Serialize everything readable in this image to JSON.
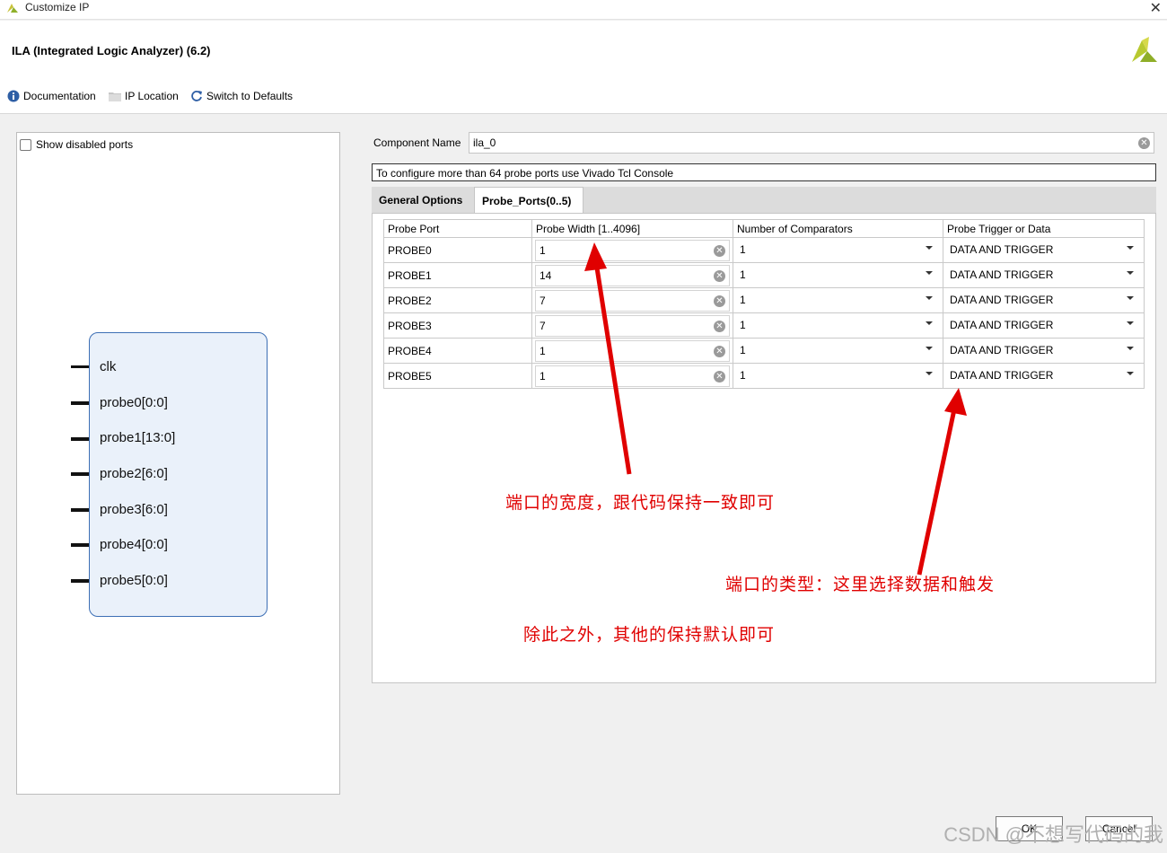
{
  "window": {
    "title": "Customize IP",
    "close_glyph": "✕"
  },
  "header": {
    "ip_name": "ILA (Integrated Logic Analyzer) (6.2)"
  },
  "toolbar": {
    "documentation": "Documentation",
    "ip_location": "IP Location",
    "switch_defaults": "Switch to Defaults"
  },
  "left": {
    "show_disabled_ports": "Show disabled ports",
    "ports": [
      "clk",
      "probe0[0:0]",
      "probe1[13:0]",
      "probe2[6:0]",
      "probe3[6:0]",
      "probe4[0:0]",
      "probe5[0:0]"
    ]
  },
  "component": {
    "label": "Component Name",
    "value": "ila_0"
  },
  "info_text": "To configure more than 64 probe ports use Vivado Tcl Console",
  "tabs": [
    "General Options",
    "Probe_Ports(0..5)"
  ],
  "table": {
    "headers": [
      "Probe Port",
      "Probe Width [1..4096]",
      "Number of Comparators",
      "Probe Trigger or Data"
    ],
    "rows": [
      {
        "port": "PROBE0",
        "width": "1",
        "comparators": "1",
        "type": "DATA AND TRIGGER"
      },
      {
        "port": "PROBE1",
        "width": "14",
        "comparators": "1",
        "type": "DATA AND TRIGGER"
      },
      {
        "port": "PROBE2",
        "width": "7",
        "comparators": "1",
        "type": "DATA AND TRIGGER"
      },
      {
        "port": "PROBE3",
        "width": "7",
        "comparators": "1",
        "type": "DATA AND TRIGGER"
      },
      {
        "port": "PROBE4",
        "width": "1",
        "comparators": "1",
        "type": "DATA AND TRIGGER"
      },
      {
        "port": "PROBE5",
        "width": "1",
        "comparators": "1",
        "type": "DATA AND TRIGGER"
      }
    ]
  },
  "annotations": {
    "width_note": "端口的宽度，跟代码保持一致即可",
    "type_note": "端口的类型：这里选择数据和触发",
    "default_note": "除此之外，其他的保持默认即可"
  },
  "buttons": {
    "ok": "OK",
    "cancel": "Cancel"
  },
  "watermark": "CSDN @不想写代码的我",
  "colors": {
    "annotation": "#e00000",
    "symbol_fill": "#eaf1fa",
    "symbol_border": "#3d6fb5",
    "logo": "#a8c22a"
  }
}
